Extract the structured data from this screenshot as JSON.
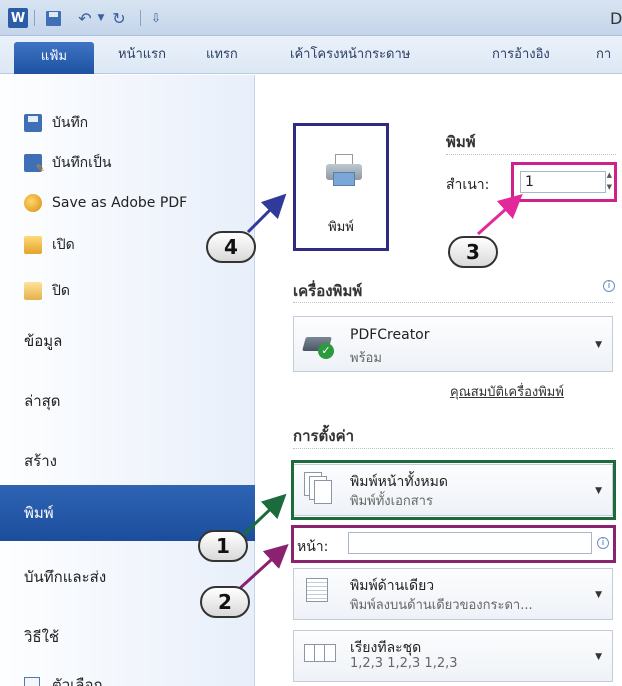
{
  "titlebar": {
    "app_logo": "W",
    "title_fragment": "D",
    "icons": [
      "word-logo-icon",
      "save-icon",
      "undo-icon",
      "dropdown-icon",
      "redo-icon",
      "customize-icon"
    ]
  },
  "tabs": [
    "แฟ้ม",
    "หน้าแรก",
    "แทรก",
    "เค้าโครงหน้ากระดาษ",
    "การอ้างอิง",
    "กา"
  ],
  "backstage": {
    "commands": [
      "บันทึก",
      "บันทึกเป็น",
      "Save as Adobe PDF",
      "เปิด",
      "ปิด"
    ],
    "nav": [
      "ข้อมูล",
      "ล่าสุด",
      "สร้าง",
      "พิมพ์",
      "บันทึกและส่ง",
      "วิธีใช้",
      "ตัวเลือก"
    ],
    "active_nav": "พิมพ์"
  },
  "print": {
    "heading": "พิมพ์",
    "button_label": "พิมพ์",
    "copies_label": "สำเนา:",
    "copies_value": "1"
  },
  "printer": {
    "heading": "เครื่องพิมพ์",
    "name": "PDFCreator",
    "status": "พร้อม",
    "properties_link": "คุณสมบัติเครื่องพิมพ์"
  },
  "settings": {
    "heading": "การตั้งค่า",
    "range_main": "พิมพ์หน้าทั้งหมด",
    "range_sub": "พิมพ์ทั้งเอกสาร",
    "pages_label": "หน้า:",
    "pages_value": "",
    "sides_main": "พิมพ์ด้านเดียว",
    "sides_sub": "พิมพ์ลงบนด้านเดียวของกระดา...",
    "collate_main": "เรียงทีละชุด",
    "collate_sub": "1,2,3    1,2,3    1,2,3"
  },
  "callouts": [
    "1",
    "2",
    "3",
    "4"
  ],
  "colors": {
    "file_tab": "#1e52a3",
    "active_nav": "#1b4d9c",
    "print_button_border": "#2f2a82",
    "copies_highlight": "#d0208a",
    "range_highlight": "#1c6b3d",
    "pages_highlight": "#8a2270"
  }
}
